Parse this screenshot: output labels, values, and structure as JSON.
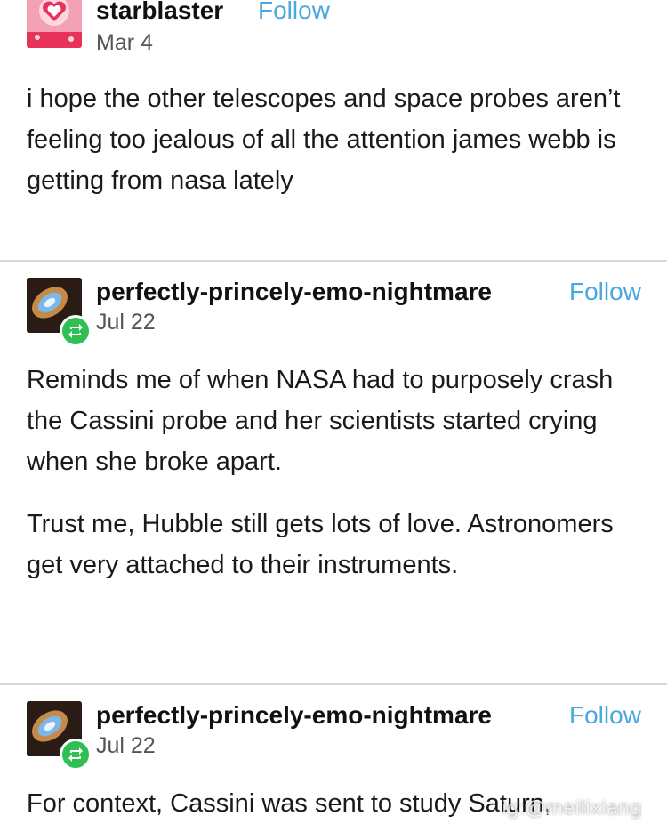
{
  "posts": [
    {
      "username": "starblaster",
      "follow_label": "Follow",
      "date": "Mar 4",
      "avatar_icon": "heart-avatar-icon",
      "paragraphs": [
        "i hope the other telescopes and space probes aren’t feeling too jealous of all the attention james webb is getting from nasa lately"
      ]
    },
    {
      "username": "perfectly-princely-emo-nightmare",
      "follow_label": "Follow",
      "date": "Jul 22",
      "avatar_icon": "nebula-avatar-icon",
      "badge_icon": "reblog-icon",
      "paragraphs": [
        "Reminds me of when NASA had to purposely crash the Cassini probe and her scientists started crying when she broke apart.",
        "Trust me, Hubble still gets lots of love. Astronomers get very attached to their instruments."
      ]
    },
    {
      "username": "perfectly-princely-emo-nightmare",
      "follow_label": "Follow",
      "date": "Jul 22",
      "avatar_icon": "nebula-avatar-icon",
      "badge_icon": "reblog-icon",
      "paragraphs": [
        "For context, Cassini was sent to study Saturn,"
      ]
    }
  ],
  "watermark": "ig:@meilixiang",
  "colors": {
    "follow": "#4aa8e0",
    "reblog_badge": "#2fbf52",
    "divider": "#d8d8d8"
  }
}
